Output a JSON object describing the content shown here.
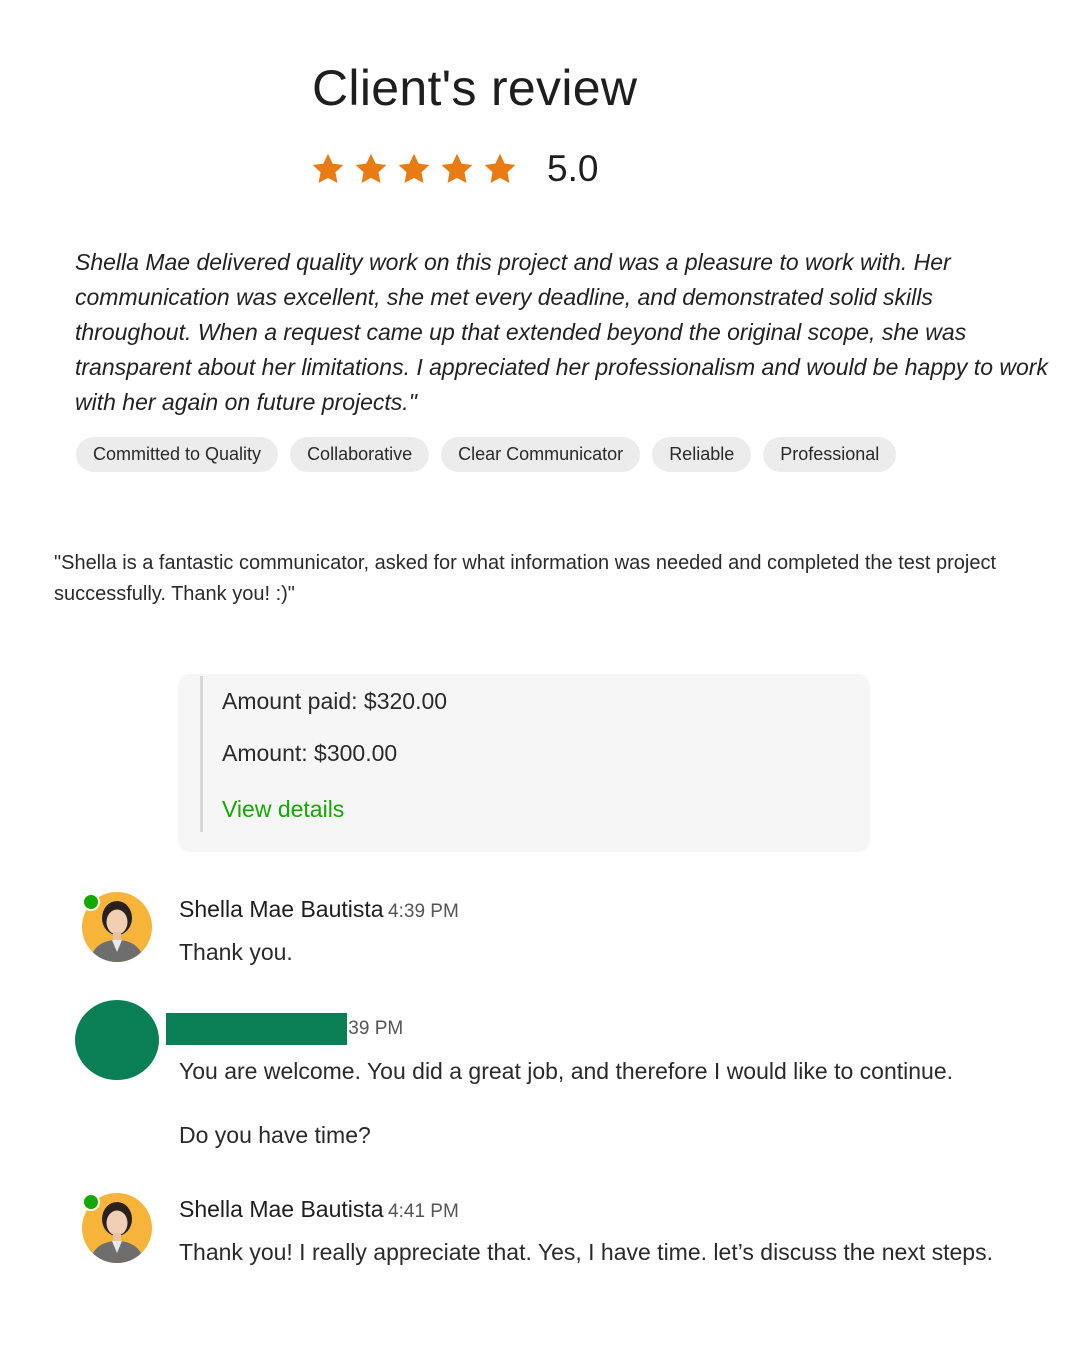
{
  "review": {
    "title": "Client's review",
    "rating": "5.0",
    "stars": 5,
    "star_color": "#e87c13",
    "text": "Shella Mae delivered quality work on this project and was a pleasure to work with. Her communication was excellent, she met every deadline, and demonstrated solid skills throughout. When a request came up that extended beyond the original scope, she was transparent about her limitations. I appreciated her professionalism and would be happy to work with her again on future projects.\"",
    "tags": [
      "Committed to Quality",
      "Collaborative",
      "Clear Communicator",
      "Reliable",
      "Professional"
    ]
  },
  "quote": "\"Shella is a fantastic communicator, asked for what information was needed and completed the test project successfully. Thank you! :)\"",
  "payment": {
    "amount_paid": "Amount paid: $320.00",
    "amount": "Amount: $300.00",
    "view_details": "View details",
    "link_color": "#14a800"
  },
  "messages": [
    {
      "name": "Shella Mae Bautista",
      "time": "4:39 PM",
      "texts": [
        "Thank you."
      ],
      "online": true
    },
    {
      "name": "",
      "time": "4:39 PM",
      "time_visible": ":39 PM",
      "texts": [
        "You are welcome. You did a great job, and therefore I would like to continue.",
        "Do you have time?"
      ],
      "avatar_color": "#0a7f55"
    },
    {
      "name": "Shella Mae Bautista",
      "time": "4:41 PM",
      "texts": [
        "Thank you! I really appreciate that. Yes, I have time. let’s discuss the next steps."
      ],
      "online": true
    }
  ]
}
